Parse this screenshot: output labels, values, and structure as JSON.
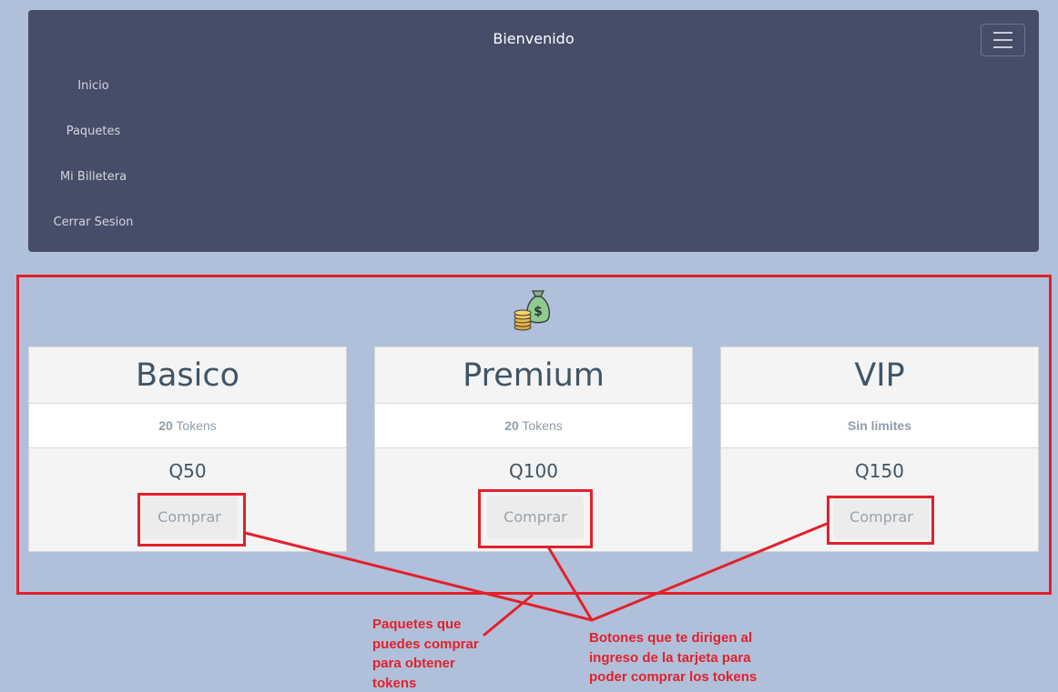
{
  "navbar": {
    "brand": "Bienvenido",
    "menu_icon": "hamburger-menu-icon",
    "items": [
      {
        "label": "Inicio"
      },
      {
        "label": "Paquetes"
      },
      {
        "label": "Mi Billetera"
      },
      {
        "label": "Cerrar Sesion"
      }
    ]
  },
  "section": {
    "icon": "money-bag-coins-icon"
  },
  "packages": [
    {
      "name": "Basico",
      "amount": "20",
      "unit": "Tokens",
      "price": "Q50",
      "button": "Comprar"
    },
    {
      "name": "Premium",
      "amount": "20",
      "unit": "Tokens",
      "price": "Q100",
      "button": "Comprar"
    },
    {
      "name": "VIP",
      "amount": "Sin limites",
      "unit": "",
      "price": "Q150",
      "button": "Comprar"
    }
  ],
  "annotations": {
    "packages_note": "Paquetes que\npuedes comprar\npara obtener\ntokens",
    "buttons_note": "Botones que te dirigen al\ningreso de la tarjeta para\npoder comprar los tokens",
    "color": "#e2212b"
  },
  "colors": {
    "page_bg": "#b0c0da",
    "navbar_bg": "#464d69",
    "card_bg": "#f4f4f4",
    "title_text": "#3f5566"
  }
}
